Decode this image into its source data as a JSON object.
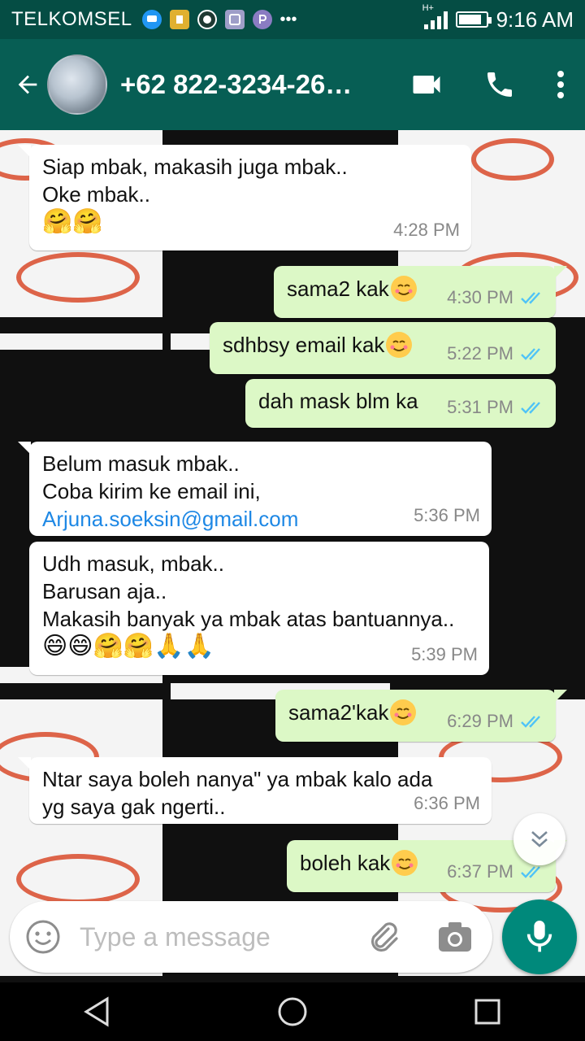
{
  "status_bar": {
    "carrier": "TELKOMSEL",
    "network": "H+",
    "time": "9:16 AM",
    "battery_level": 0.85
  },
  "header": {
    "contact": "+62 822-3234-26…"
  },
  "messages": [
    {
      "direction": "in",
      "lines": [
        "Siap mbak, makasih juga mbak..",
        "Oke mbak..",
        "🤗🤗"
      ],
      "time": "4:28 PM"
    },
    {
      "direction": "out",
      "text": "sama2 kak",
      "emoji": "smiling-face",
      "time": "4:30 PM",
      "status": "read"
    },
    {
      "direction": "out",
      "text": "sdhbsy email kak",
      "emoji": "smiling-face",
      "time": "5:22 PM",
      "status": "read"
    },
    {
      "direction": "out",
      "text": "dah mask blm ka",
      "time": "5:31 PM",
      "status": "read"
    },
    {
      "direction": "in",
      "lines": [
        "Belum masuk mbak..",
        "Coba kirim ke email ini,"
      ],
      "link": "Arjuna.soeksin@gmail.com",
      "time": "5:36 PM"
    },
    {
      "direction": "in",
      "lines": [
        "Udh masuk, mbak..",
        "Barusan aja..",
        "Makasih banyak ya mbak atas bantuannya..",
        "😄😄🤗🤗🙏🙏"
      ],
      "time": "5:39 PM"
    },
    {
      "direction": "out",
      "text": "sama2'kak",
      "emoji": "smiling-face",
      "time": "6:29 PM",
      "status": "read"
    },
    {
      "direction": "in",
      "lines": [
        "Ntar saya boleh nanya\" ya mbak kalo ada",
        "yg saya gak ngerti.."
      ],
      "time": "6:36 PM"
    },
    {
      "direction": "out",
      "text": "boleh kak",
      "emoji": "smiling-face",
      "time": "6:37 PM",
      "status": "read"
    }
  ],
  "composer": {
    "placeholder": "Type a message"
  },
  "colors": {
    "toolbar": "#075e54",
    "status_bar": "#054d44",
    "outgoing_bubble": "#dcf8c6",
    "incoming_bubble": "#ffffff",
    "read_ticks": "#4fc3f7",
    "mic_button": "#00897b",
    "link": "#1e88e5"
  }
}
